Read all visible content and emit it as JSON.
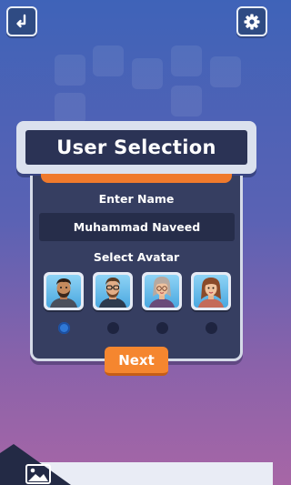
{
  "toolbar": {
    "back_icon": "return-arrow-icon",
    "settings_icon": "gear-icon"
  },
  "header": {
    "title": "User Selection"
  },
  "form": {
    "enter_name_label": "Enter Name",
    "name_value": "Muhammad Naveed",
    "select_avatar_label": "Select Avatar",
    "avatars": [
      {
        "icon": "male-bearded-avatar-icon",
        "selected": true
      },
      {
        "icon": "male-glasses-avatar-icon",
        "selected": false
      },
      {
        "icon": "female-glasses-avatar-icon",
        "selected": false
      },
      {
        "icon": "female-avatar-icon",
        "selected": false
      }
    ]
  },
  "actions": {
    "next_label": "Next"
  },
  "bottom": {
    "gallery_icon": "image-gallery-icon"
  },
  "colors": {
    "accent_orange": "#f5862f",
    "panel_dark": "#363e61",
    "selected_dot": "#2f78d6"
  }
}
